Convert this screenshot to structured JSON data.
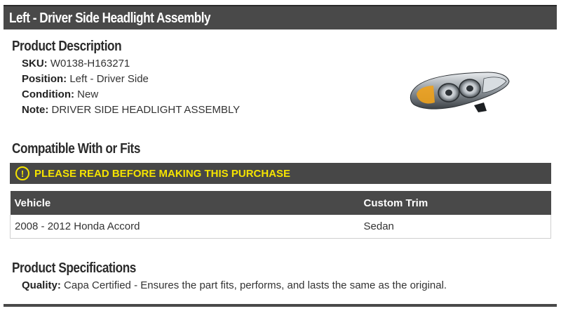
{
  "header": {
    "title": "Left - Driver Side Headlight Assembly"
  },
  "description": {
    "heading": "Product Description",
    "fields": [
      {
        "label": "SKU:",
        "value": "W0138-H163271"
      },
      {
        "label": "Position:",
        "value": "Left - Driver Side"
      },
      {
        "label": "Condition:",
        "value": "New"
      },
      {
        "label": "Note:",
        "value": "DRIVER SIDE HEADLIGHT ASSEMBLY"
      }
    ],
    "image_icon": "headlight-image"
  },
  "compatibility": {
    "heading": "Compatible With or Fits",
    "notice": {
      "icon": "exclamation-circle-icon",
      "text": "PLEASE READ BEFORE MAKING THIS PURCHASE",
      "color": "#f5e400"
    },
    "table": {
      "headers": [
        "Vehicle",
        "Custom Trim"
      ],
      "rows": [
        [
          "2008 - 2012 Honda Accord",
          "Sedan"
        ]
      ]
    }
  },
  "specifications": {
    "heading": "Product Specifications",
    "fields": [
      {
        "label": "Quality:",
        "value": "Capa Certified - Ensures the part fits, performs, and lasts the same as the original."
      }
    ]
  },
  "colors": {
    "bar": "#494949",
    "notice_text": "#f5e400"
  }
}
